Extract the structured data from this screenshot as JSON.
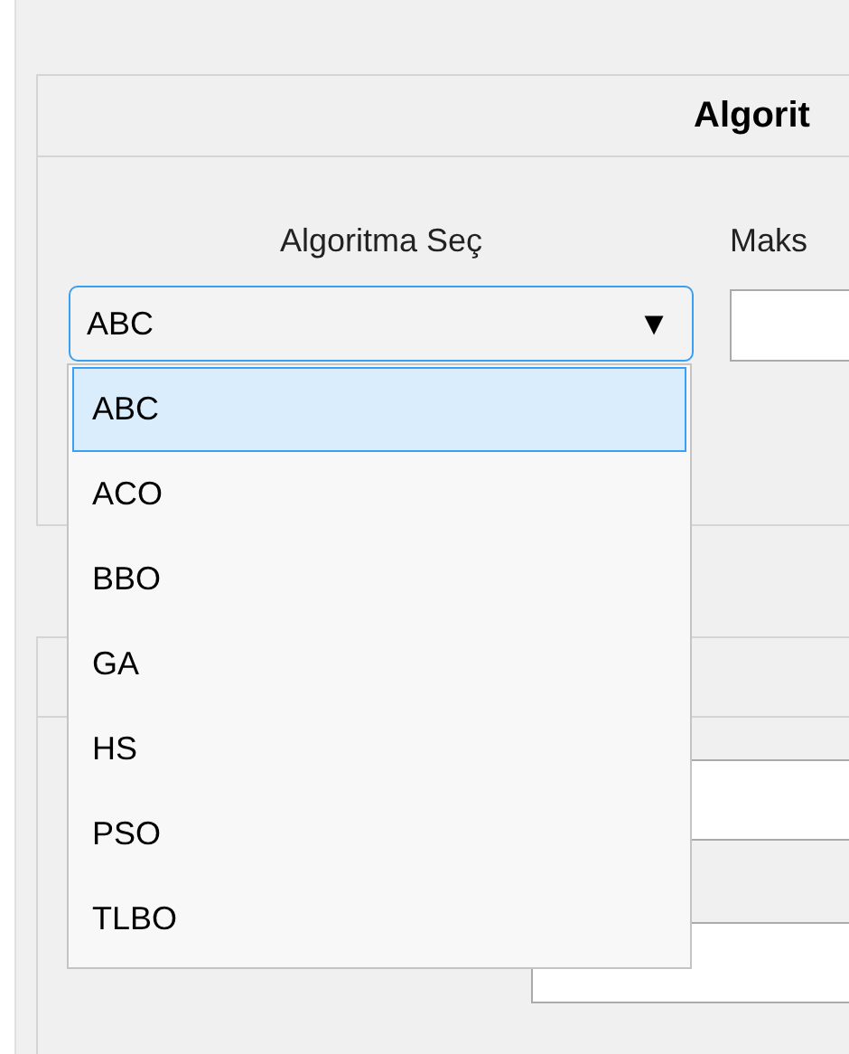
{
  "algorithm_panel": {
    "title": "Algorit",
    "select": {
      "label": "Algoritma Seç",
      "value": "ABC",
      "arrow": "▼",
      "expanded": true,
      "options": [
        {
          "label": "ABC",
          "selected": true
        },
        {
          "label": "ACO",
          "selected": false
        },
        {
          "label": "BBO",
          "selected": false
        },
        {
          "label": "GA",
          "selected": false
        },
        {
          "label": "HS",
          "selected": false
        },
        {
          "label": "PSO",
          "selected": false
        },
        {
          "label": "TLBO",
          "selected": false
        }
      ]
    },
    "max_label": "Maks"
  }
}
